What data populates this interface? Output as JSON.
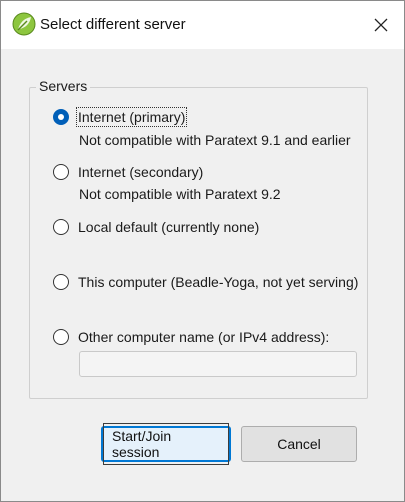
{
  "window": {
    "title": "Select different server",
    "app_icon": "paratext-leaf-icon",
    "close_icon": "close-icon"
  },
  "servers": {
    "legend": "Servers",
    "options": [
      {
        "label": "Internet (primary)",
        "note": "Not compatible with Paratext 9.1 and earlier",
        "checked": true
      },
      {
        "label": "Internet (secondary)",
        "note": "Not compatible with Paratext 9.2",
        "checked": false
      },
      {
        "label": "Local default (currently none)",
        "note": "",
        "checked": false
      },
      {
        "label": "This computer (Beadle-Yoga, not yet serving)",
        "note": "",
        "checked": false
      },
      {
        "label": "Other computer name (or IPv4 address):",
        "note": "",
        "checked": false
      }
    ],
    "address_value": ""
  },
  "buttons": {
    "start_join": "Start/Join session",
    "cancel": "Cancel"
  },
  "colors": {
    "accent": "#005fb8",
    "default_button_border": "#0078d4"
  }
}
